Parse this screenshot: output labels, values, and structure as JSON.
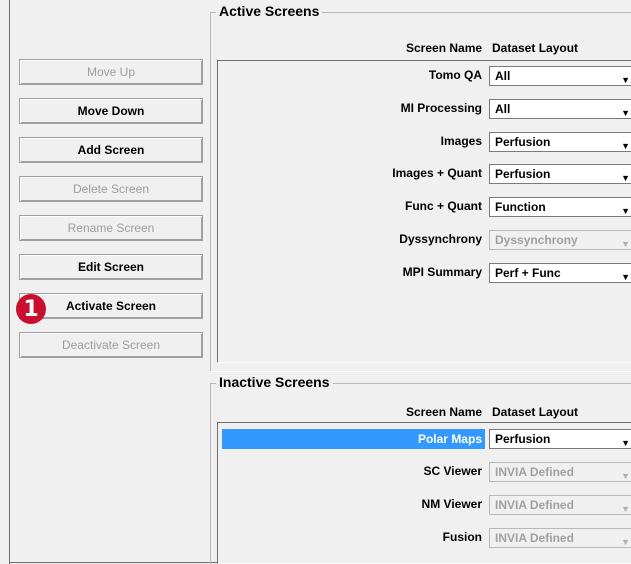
{
  "buttons": {
    "move_up": "Move Up",
    "move_down": "Move Down",
    "add_screen": "Add Screen",
    "delete_screen": "Delete Screen",
    "rename_screen": "Rename Screen",
    "edit_screen": "Edit Screen",
    "activate_screen": "Activate Screen",
    "deactivate_screen": "Deactivate Screen"
  },
  "callout": {
    "number": "1",
    "color": "#c8102e"
  },
  "active": {
    "title": "Active Screens",
    "col_name": "Screen Name",
    "col_layout": "Dataset Layout",
    "rows": [
      {
        "name": "Tomo QA",
        "layout": "All"
      },
      {
        "name": "MI Processing",
        "layout": "All"
      },
      {
        "name": "Images",
        "layout": "Perfusion"
      },
      {
        "name": "Images + Quant",
        "layout": "Perfusion"
      },
      {
        "name": "Func + Quant",
        "layout": "Function"
      },
      {
        "name": "Dyssynchrony",
        "layout": "Dyssynchrony"
      },
      {
        "name": "MPI Summary",
        "layout": "Perf + Func"
      }
    ]
  },
  "inactive": {
    "title": "Inactive Screens",
    "col_name": "Screen Name",
    "col_layout": "Dataset Layout",
    "rows": [
      {
        "name": "Polar Maps",
        "layout": "Perfusion"
      },
      {
        "name": "SC Viewer",
        "layout": "INVIA Defined"
      },
      {
        "name": "NM Viewer",
        "layout": "INVIA Defined"
      },
      {
        "name": "Fusion",
        "layout": "INVIA Defined"
      }
    ]
  },
  "selection_color": "#3399ff",
  "icons": {
    "dropdown": "chevron-down-icon"
  }
}
